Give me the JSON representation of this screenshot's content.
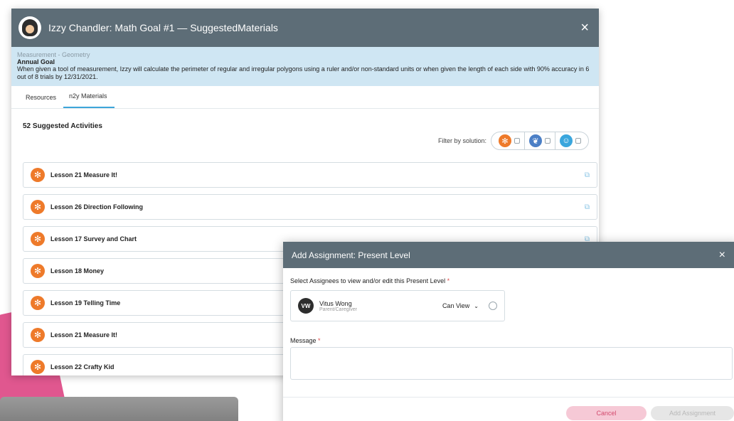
{
  "window": {
    "title": "Izzy Chandler: Math Goal #1 — SuggestedMaterials",
    "close_glyph": "×"
  },
  "goal": {
    "category": "Measurement - Geometry",
    "label": "Annual Goal",
    "text": "When given a tool of measurement, Izzy will calculate the perimeter of regular and irregular polygons using a ruler and/or non-standard units or when given the length of each side with 90% accuracy in 6 out of 8 trials by 12/31/2021."
  },
  "tabs": [
    {
      "label": "Resources",
      "active": false
    },
    {
      "label": "n2y Materials",
      "active": true
    }
  ],
  "activities": {
    "count_label": "52 Suggested Activities",
    "filter_label": "Filter by solution:",
    "filters": [
      {
        "icon": "snowflake-icon",
        "color": "#ee7a2a"
      },
      {
        "icon": "leaf-icon",
        "color": "#4b7fc6"
      },
      {
        "icon": "person-icon",
        "color": "#3aa6dd"
      }
    ],
    "items": [
      {
        "title": "Lesson 21 Measure It!"
      },
      {
        "title": "Lesson 26 Direction Following"
      },
      {
        "title": "Lesson 17 Survey and Chart"
      },
      {
        "title": "Lesson 18 Money"
      },
      {
        "title": "Lesson 19 Telling Time"
      },
      {
        "title": "Lesson 21 Measure It!"
      },
      {
        "title": "Lesson 22 Crafty Kid"
      }
    ]
  },
  "dialog": {
    "title": "Add Assignment: Present Level",
    "assignees_label": "Select Assignees to view and/or edit this Present Level",
    "required_mark": "*",
    "assignee": {
      "initials": "VW",
      "name": "Vitus Wong",
      "role": "Parent/Caregiver",
      "permission": "Can View"
    },
    "message_label": "Message",
    "cancel_label": "Cancel",
    "add_label": "Add Assignment"
  },
  "colors": {
    "header": "#5d6d77",
    "goal_bg": "#cfe6f3",
    "accent_orange": "#ee7a2a",
    "tab_accent": "#3da5d9",
    "cancel_bg": "#f6c9d6"
  }
}
